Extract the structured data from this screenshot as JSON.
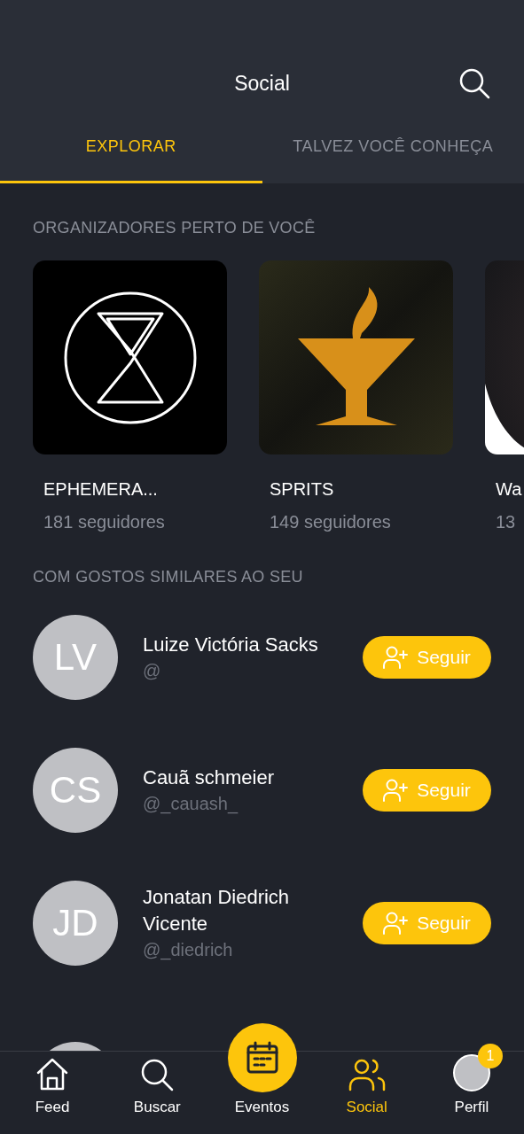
{
  "header": {
    "title": "Social"
  },
  "tabs": [
    {
      "label": "EXPLORAR",
      "selected": true
    },
    {
      "label": "TALVEZ VOCÊ CONHEÇA",
      "selected": false
    }
  ],
  "organizers": {
    "title": "ORGANIZADORES PERTO DE VOCÊ",
    "items": [
      {
        "name": "EPHEMERA...",
        "followers": "181 seguidores"
      },
      {
        "name": "SPRITS",
        "followers": "149 seguidores"
      },
      {
        "name": "Wa",
        "followers": "13"
      }
    ]
  },
  "similar": {
    "title": "COM GOSTOS SIMILARES AO SEU",
    "people": [
      {
        "initials": "LV",
        "name": "Luize Victória Sacks",
        "handle": "@",
        "button": "Seguir"
      },
      {
        "initials": "CS",
        "name": "Cauã schmeier",
        "handle": "@_cauash_",
        "button": "Seguir"
      },
      {
        "initials": "JD",
        "name": "Jonatan Diedrich Vicente",
        "handle": "@_diedrich",
        "button": "Seguir"
      }
    ]
  },
  "nav": [
    {
      "label": "Feed",
      "kind": "icon",
      "selected": false
    },
    {
      "label": "Buscar",
      "kind": "icon",
      "selected": false
    },
    {
      "label": "Eventos",
      "kind": "fab",
      "selected": false
    },
    {
      "label": "Social",
      "kind": "icon",
      "selected": true
    },
    {
      "label": "Perfil",
      "kind": "avatar",
      "selected": false,
      "badge": "1"
    }
  ]
}
